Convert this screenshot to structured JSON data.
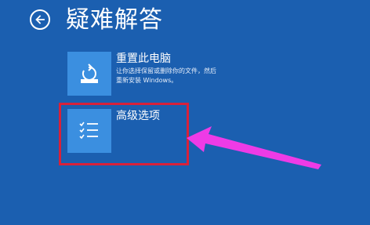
{
  "header": {
    "title": "疑难解答",
    "back_icon": "back-arrow-icon"
  },
  "options": [
    {
      "icon": "reset-pc-icon",
      "label": "重置此电脑",
      "description": "让你选择保留或删除你的文件，然后重新安装 Windows。"
    },
    {
      "icon": "checklist-icon",
      "label": "高级选项",
      "description": ""
    }
  ],
  "annotations": {
    "highlight_color": "#d8213a",
    "arrow_color": "#ee3be6"
  },
  "colors": {
    "background": "#1b5fb0",
    "tile": "#3b8fe0",
    "text": "#ffffff"
  }
}
